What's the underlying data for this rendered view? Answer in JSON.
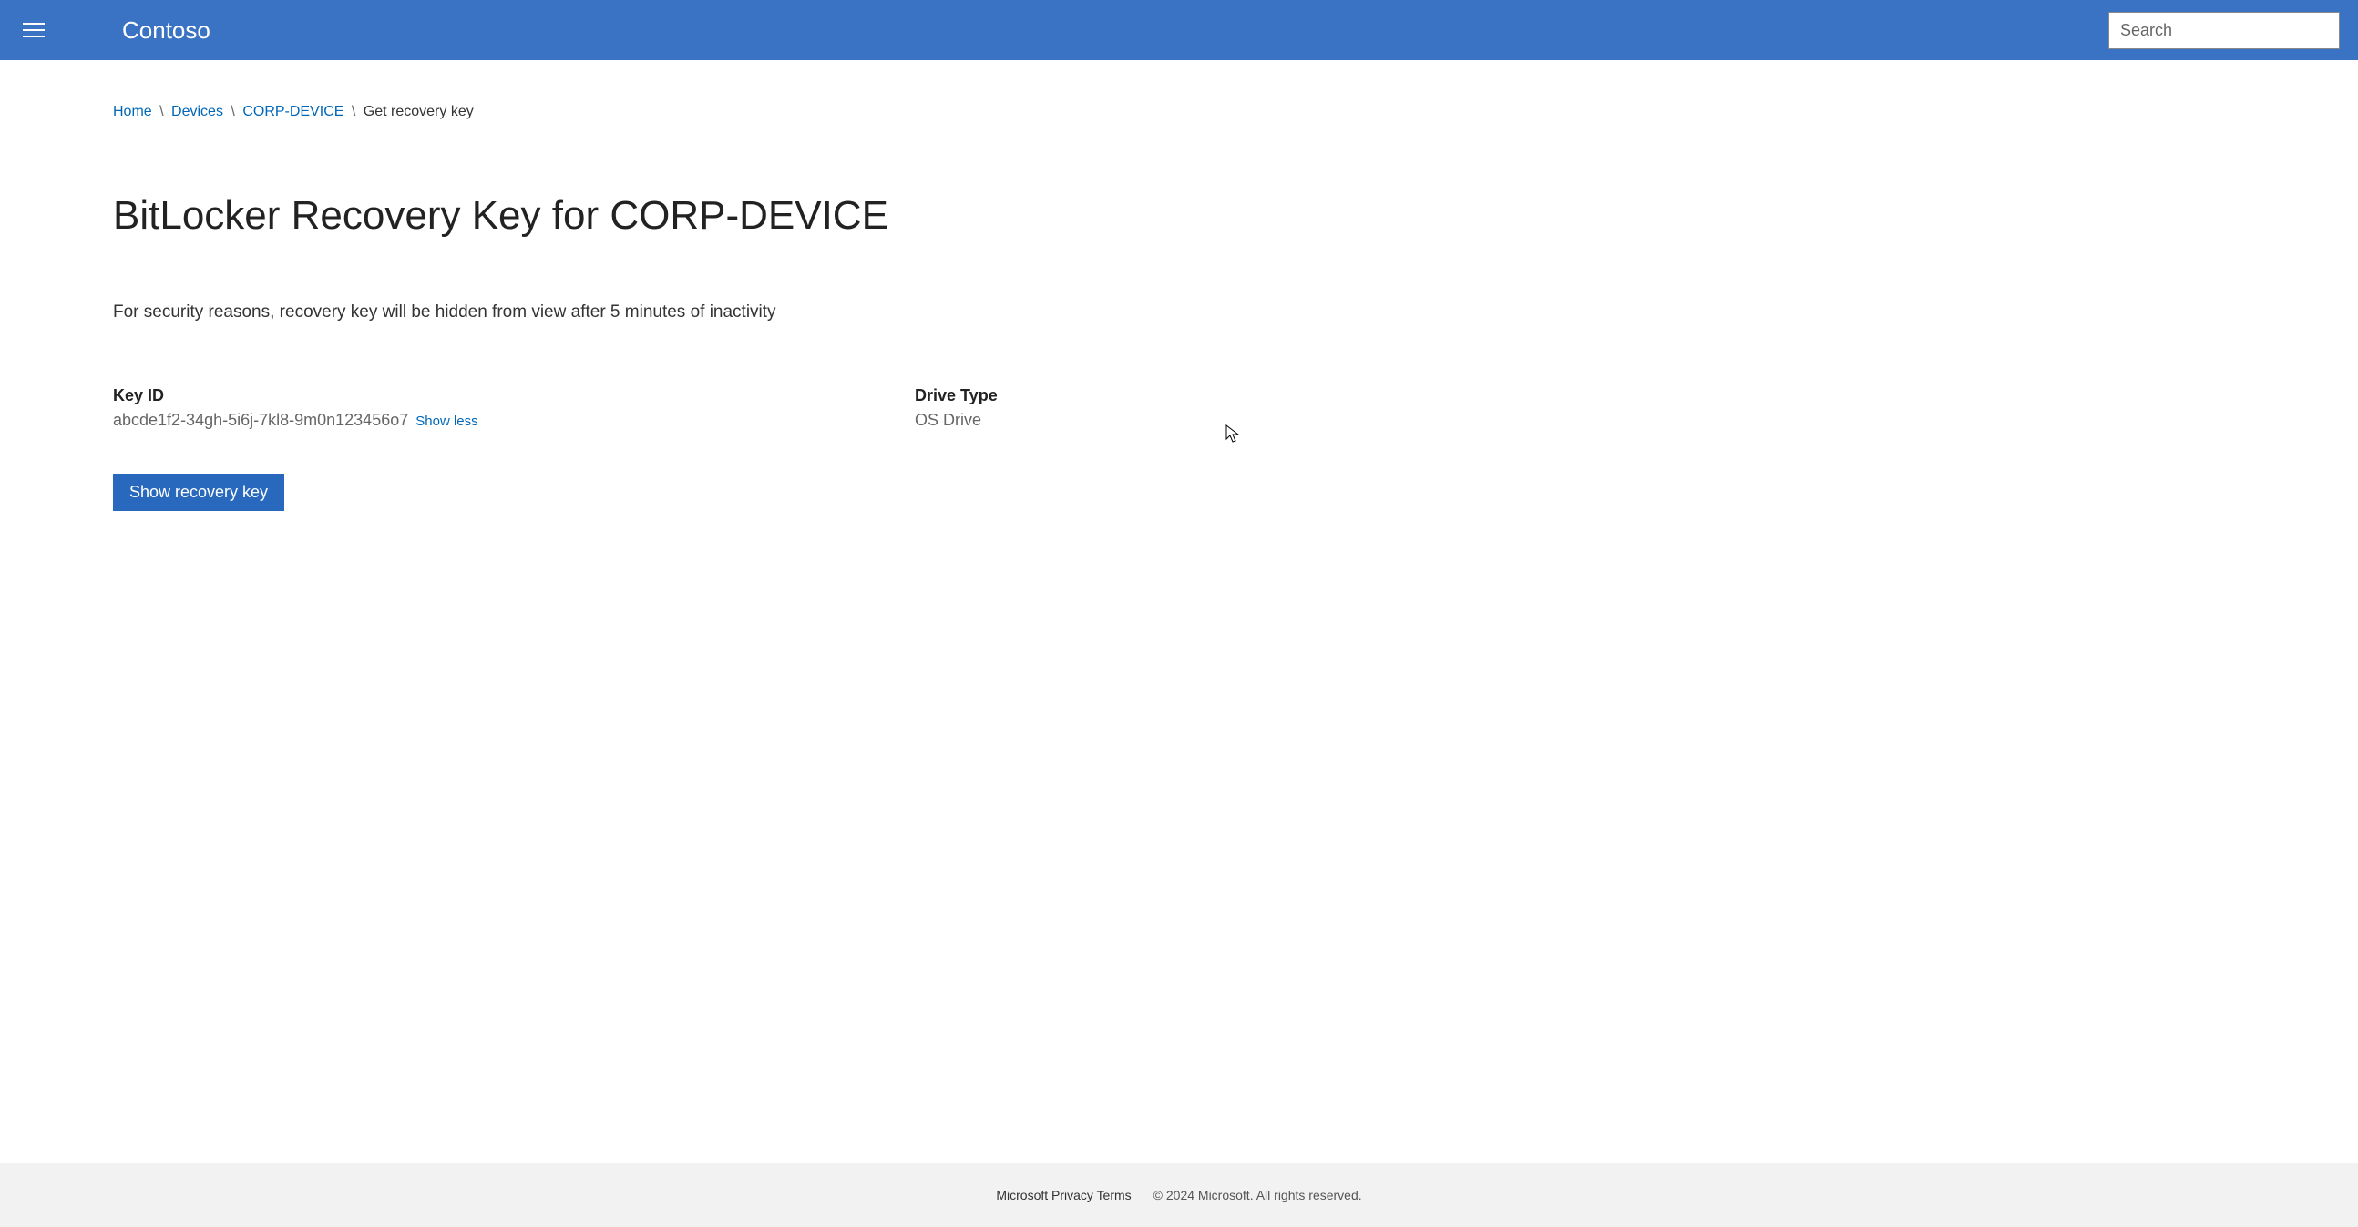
{
  "header": {
    "brand": "Contoso",
    "search_placeholder": "Search"
  },
  "breadcrumb": {
    "items": [
      {
        "label": "Home",
        "link": true
      },
      {
        "label": "Devices",
        "link": true
      },
      {
        "label": "CORP-DEVICE",
        "link": true
      },
      {
        "label": "Get recovery key",
        "link": false
      }
    ]
  },
  "page": {
    "title": "BitLocker Recovery Key for CORP-DEVICE",
    "info": "For security reasons, recovery key will be hidden from view after 5 minutes of inactivity",
    "key_id_label": "Key ID",
    "key_id_value": "abcde1f2-34gh-5i6j-7kl8-9m0n123456o7",
    "toggle_label": "Show less",
    "drive_type_label": "Drive Type",
    "drive_type_value": "OS Drive",
    "show_button": "Show recovery key"
  },
  "footer": {
    "privacy_link": "Microsoft Privacy Terms",
    "copyright": "© 2024 Microsoft. All rights reserved."
  }
}
